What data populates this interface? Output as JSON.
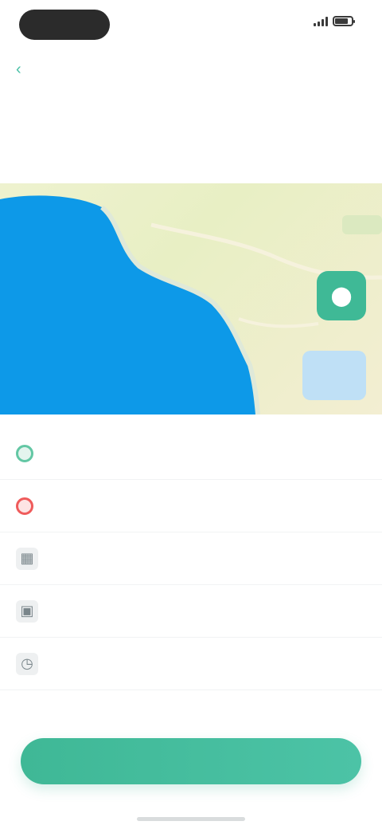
{
  "status_bar": {
    "time": "",
    "battery_level": 0.8
  },
  "header": {
    "back_label": "",
    "title": ""
  },
  "summary": {
    "line_1": "",
    "line_2": ""
  },
  "map": {
    "label": "",
    "pin_icon": "location-pin-icon",
    "water_color": "#0d99e8",
    "land_color": "#eaf0c8",
    "pin_color": "#3fb996"
  },
  "details": {
    "start_label": "",
    "end_label": "",
    "info_1": "",
    "info_2": "",
    "time_from": "",
    "time_separator": "",
    "time_to": ""
  },
  "cta": {
    "label": "",
    "color": "#45bd9f"
  }
}
